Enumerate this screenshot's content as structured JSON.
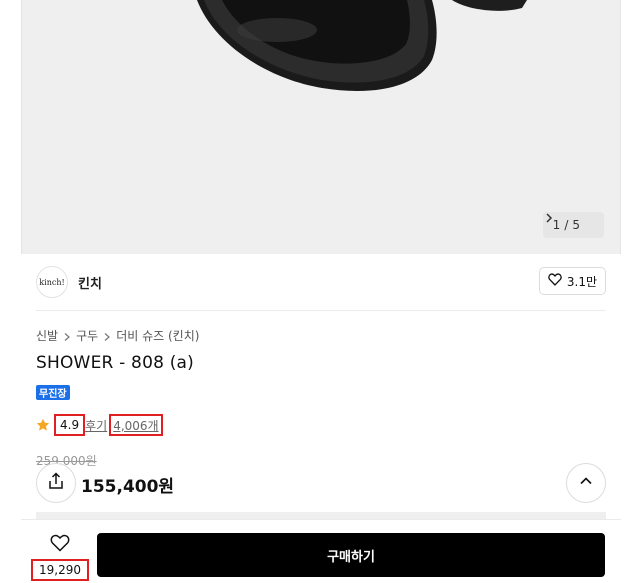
{
  "hero": {
    "pager_current": "1",
    "pager_separator": "/",
    "pager_total": "5"
  },
  "brand": {
    "logo_text": "kinch!",
    "name": "킨치",
    "like_count": "3.1만"
  },
  "breadcrumb": [
    "신발",
    "구두",
    "더비 슈즈 (킨치)"
  ],
  "product": {
    "title": "SHOWER - 808 (a)",
    "badge": "무진장",
    "rating": "4.9",
    "review_label": "후기",
    "review_count": "4,006개",
    "original_price": "259,000원",
    "price": "155,400원"
  },
  "bottom_bar": {
    "wish_count": "19,290",
    "buy_label": "구매하기"
  },
  "colors": {
    "badge": "#1b6fe8",
    "highlight_box": "#e02020",
    "star": "#f5a623",
    "buy_button": "#000000"
  },
  "icons": [
    "chevron-right-icon",
    "heart-icon",
    "star-icon",
    "share-icon",
    "chevron-up-icon"
  ]
}
